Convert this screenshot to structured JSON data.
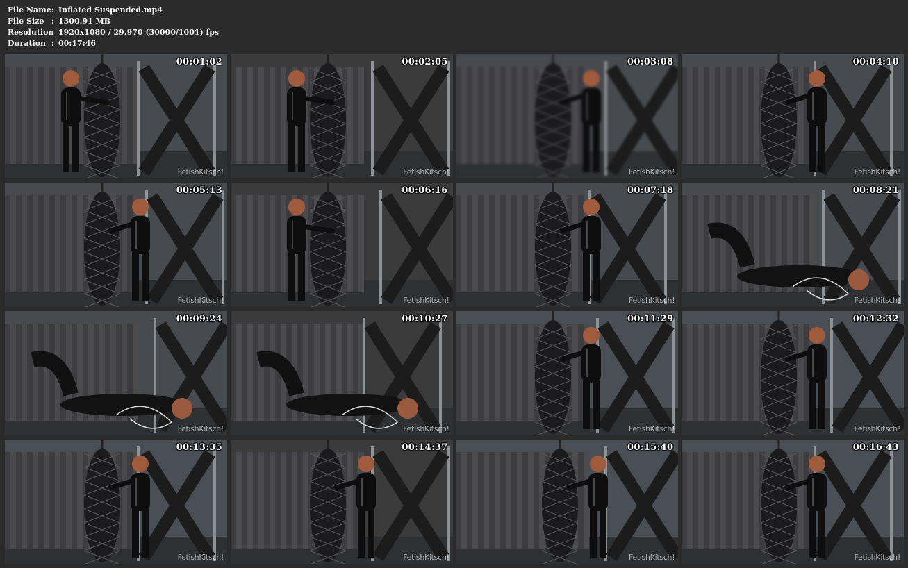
{
  "info": {
    "file_name_label": "File Name",
    "file_name_value": "Inflated Suspended.mp4",
    "file_size_label": "File Size",
    "file_size_value": "1300.91 MB",
    "resolution_label": "Resolution",
    "resolution_value": "1920x1080 / 29.970 (30000/1001) fps",
    "duration_label": "Duration",
    "duration_value": "00:17:46",
    "separator": ":"
  },
  "watermark": "FetishKitsch!",
  "thumbnails": [
    {
      "timestamp": "00:01:02"
    },
    {
      "timestamp": "00:02:05"
    },
    {
      "timestamp": "00:03:08"
    },
    {
      "timestamp": "00:04:10"
    },
    {
      "timestamp": "00:05:13"
    },
    {
      "timestamp": "00:06:16"
    },
    {
      "timestamp": "00:07:18"
    },
    {
      "timestamp": "00:08:21"
    },
    {
      "timestamp": "00:09:24"
    },
    {
      "timestamp": "00:10:27"
    },
    {
      "timestamp": "00:11:29"
    },
    {
      "timestamp": "00:12:32"
    },
    {
      "timestamp": "00:13:35"
    },
    {
      "timestamp": "00:14:37"
    },
    {
      "timestamp": "00:15:40"
    },
    {
      "timestamp": "00:16:43"
    }
  ]
}
